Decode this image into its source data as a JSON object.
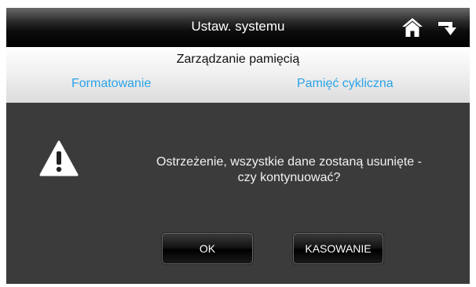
{
  "header": {
    "title": "Ustaw. systemu",
    "home_icon": "home-icon",
    "back_icon": "return-arrow-icon"
  },
  "subheader": {
    "title": "Zarządzanie pamięcią",
    "tabs": [
      {
        "label": "Formatowanie"
      },
      {
        "label": "Pamięć cykliczna"
      }
    ]
  },
  "dialog": {
    "icon": "warning-icon",
    "message_line1": "Ostrzeżenie, wszystkie dane zostaną usunięte -",
    "message_line2": "czy kontynuować?",
    "ok_label": "OK",
    "cancel_label": "KASOWANIE"
  },
  "colors": {
    "tab_text": "#2aa3e8",
    "dialog_background": "#3b3b3b",
    "title_background": "#000000"
  }
}
